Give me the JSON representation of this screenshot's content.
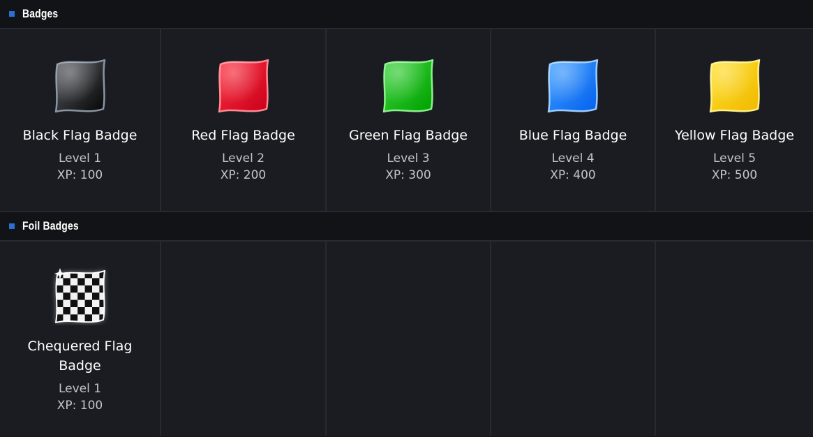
{
  "sections": [
    {
      "title": "Badges",
      "badges": [
        {
          "name": "Black Flag Badge",
          "level": "Level 1",
          "xp": "XP: 100",
          "icon": "black-flag-icon",
          "color_top": "#5a5d62",
          "color_bottom": "#050505",
          "edge": "#8a95a3"
        },
        {
          "name": "Red Flag Badge",
          "level": "Level 2",
          "xp": "XP: 200",
          "icon": "red-flag-icon",
          "color_top": "#ff3040",
          "color_bottom": "#c8001a",
          "edge": "#ff8a94"
        },
        {
          "name": "Green Flag Badge",
          "level": "Level 3",
          "xp": "XP: 300",
          "icon": "green-flag-icon",
          "color_top": "#3bd43b",
          "color_bottom": "#00a000",
          "edge": "#8cf08c"
        },
        {
          "name": "Blue Flag Badge",
          "level": "Level 4",
          "xp": "XP: 400",
          "icon": "blue-flag-icon",
          "color_top": "#3ea0ff",
          "color_bottom": "#0560ee",
          "edge": "#9ccfff"
        },
        {
          "name": "Yellow Flag Badge",
          "level": "Level 5",
          "xp": "XP: 500",
          "icon": "yellow-flag-icon",
          "color_top": "#ffe12a",
          "color_bottom": "#f0b800",
          "edge": "#fff08a"
        }
      ]
    },
    {
      "title": "Foil Badges",
      "badges": [
        {
          "name": "Chequered Flag Badge",
          "level": "Level 1",
          "xp": "XP: 100",
          "icon": "chequered-flag-icon"
        }
      ]
    }
  ],
  "colors": {
    "accent": "#2a6fd4",
    "background": "#17191d",
    "header_bg": "#121316",
    "text_primary": "#ffffff",
    "text_secondary": "#c2c5cc"
  }
}
